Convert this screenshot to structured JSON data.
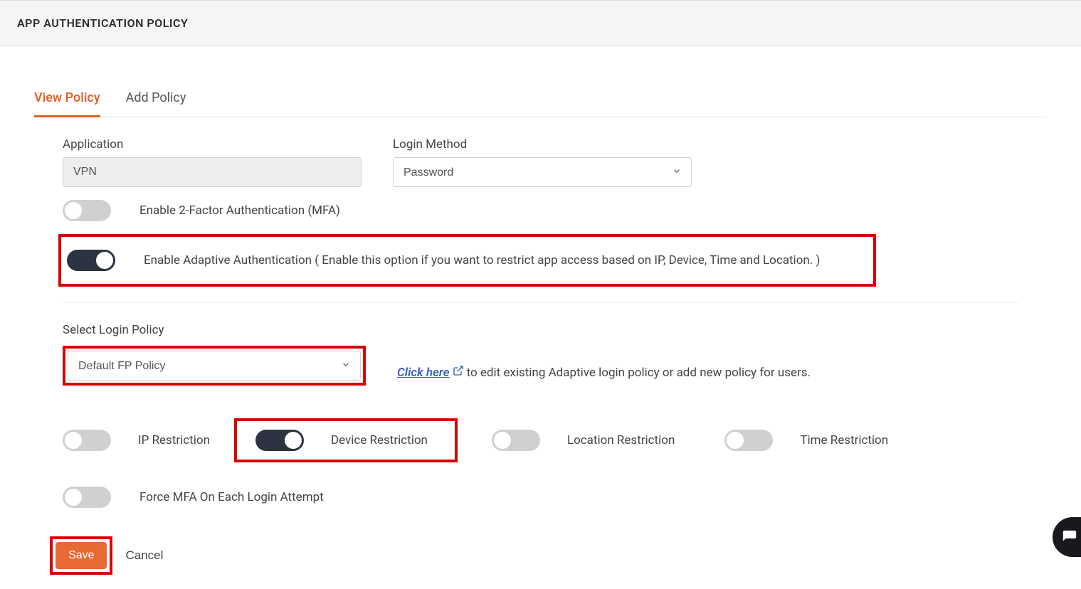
{
  "header": {
    "title": "APP AUTHENTICATION POLICY"
  },
  "tabs": {
    "view": "View Policy",
    "add": "Add Policy"
  },
  "fields": {
    "application_label": "Application",
    "application_value": "VPN",
    "login_method_label": "Login Method",
    "login_method_value": "Password",
    "mfa_label": "Enable 2-Factor Authentication (MFA)",
    "adaptive_label": "Enable Adaptive Authentication ( Enable this option if you want to restrict app access based on IP, Device, Time and Location. )",
    "select_login_policy_label": "Select Login Policy",
    "select_login_policy_value": "Default FP Policy",
    "click_here": "Click here",
    "click_here_after": " to edit existing Adaptive login policy or add new policy for users.",
    "ip_restriction": "IP Restriction",
    "device_restriction": "Device Restriction",
    "location_restriction": "Location Restriction",
    "time_restriction": "Time Restriction",
    "force_mfa": "Force MFA On Each Login Attempt",
    "save": "Save",
    "cancel": "Cancel"
  }
}
